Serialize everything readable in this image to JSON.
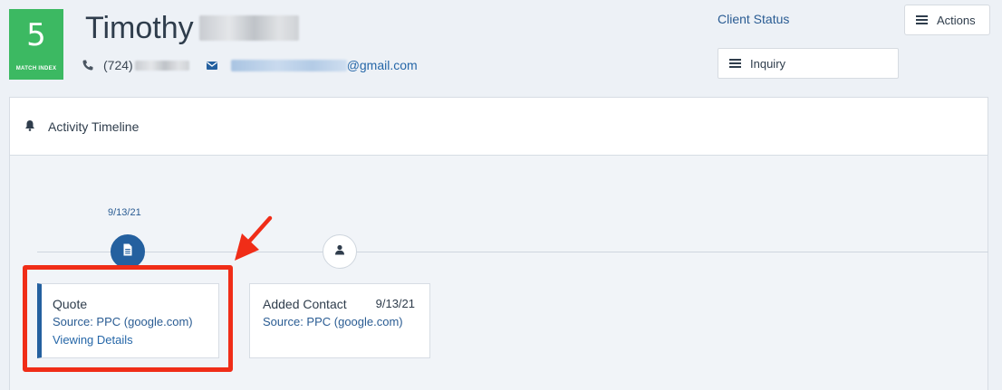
{
  "match_index": {
    "value": "5",
    "label": "MATCH INDEX"
  },
  "client": {
    "first_name": "Timothy",
    "phone_prefix": "(724)",
    "email_suffix": "@gmail.com"
  },
  "client_status": {
    "label": "Client Status",
    "value": "Inquiry"
  },
  "actions": {
    "label": "Actions"
  },
  "timeline": {
    "title": "Activity Timeline",
    "dates": [
      "9/13/21"
    ],
    "cards": [
      {
        "title": "Quote",
        "source": "Source: PPC (google.com)",
        "link": "Viewing Details"
      },
      {
        "title": "Added Contact",
        "date": "9/13/21",
        "source": "Source: PPC (google.com)"
      }
    ]
  },
  "colors": {
    "match_green": "#3cb962",
    "accent_blue": "#24609f",
    "link_blue": "#2667a8",
    "highlight_red": "#f02d18"
  },
  "icons": [
    "phone-icon",
    "envelope-icon",
    "hamburger-icon",
    "bell-icon",
    "document-icon",
    "user-icon"
  ]
}
